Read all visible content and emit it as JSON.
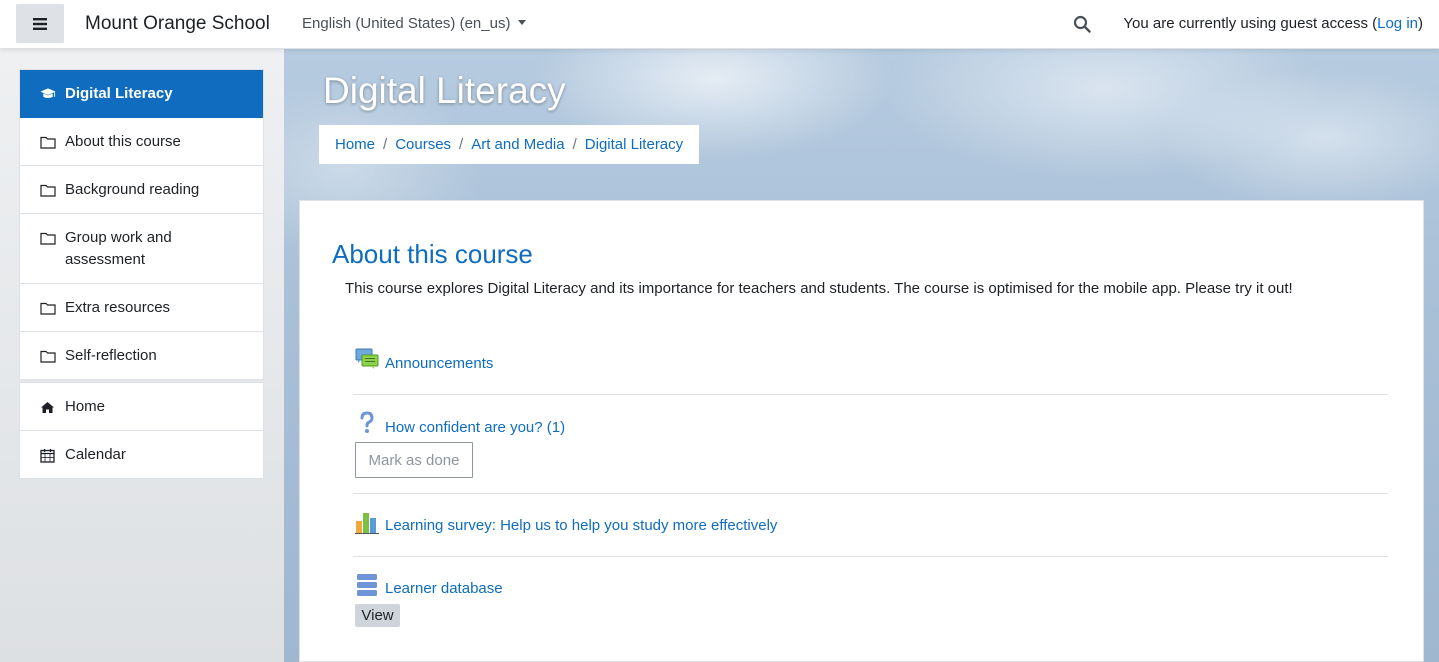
{
  "navbar": {
    "site_name": "Mount Orange School",
    "language": "English (United States) (en_us)",
    "guest_text": "You are currently using guest access (",
    "login_link": "Log in",
    "guest_close": ")"
  },
  "sidebar": {
    "course_items": [
      {
        "label": "Digital Literacy",
        "icon": "graduation-cap-icon",
        "active": true
      },
      {
        "label": "About this course",
        "icon": "folder-icon"
      },
      {
        "label": "Background reading",
        "icon": "folder-icon"
      },
      {
        "label": "Group work and assessment",
        "icon": "folder-icon"
      },
      {
        "label": "Extra resources",
        "icon": "folder-icon"
      },
      {
        "label": "Self-reflection",
        "icon": "folder-icon"
      }
    ],
    "site_items": [
      {
        "label": "Home",
        "icon": "home-icon"
      },
      {
        "label": "Calendar",
        "icon": "calendar-icon"
      }
    ]
  },
  "header": {
    "title": "Digital Literacy",
    "breadcrumb": [
      "Home",
      "Courses",
      "Art and Media",
      "Digital Literacy"
    ]
  },
  "section": {
    "title": "About this course",
    "summary": "This course explores Digital Literacy and its importance for teachers and students. The course is optimised for the mobile app. Please try it out!"
  },
  "activities": [
    {
      "name": "Announcements",
      "icon": "forum-icon"
    },
    {
      "name": "How confident are you? (1)",
      "icon": "question-icon",
      "button": "Mark as done"
    },
    {
      "name": "Learning survey: Help us to help you study more effectively",
      "icon": "survey-chart-icon"
    },
    {
      "name": "Learner database",
      "icon": "database-icon",
      "button": "View"
    }
  ],
  "colors": {
    "brand": "#0f6cbf",
    "text": "#1d2125"
  }
}
